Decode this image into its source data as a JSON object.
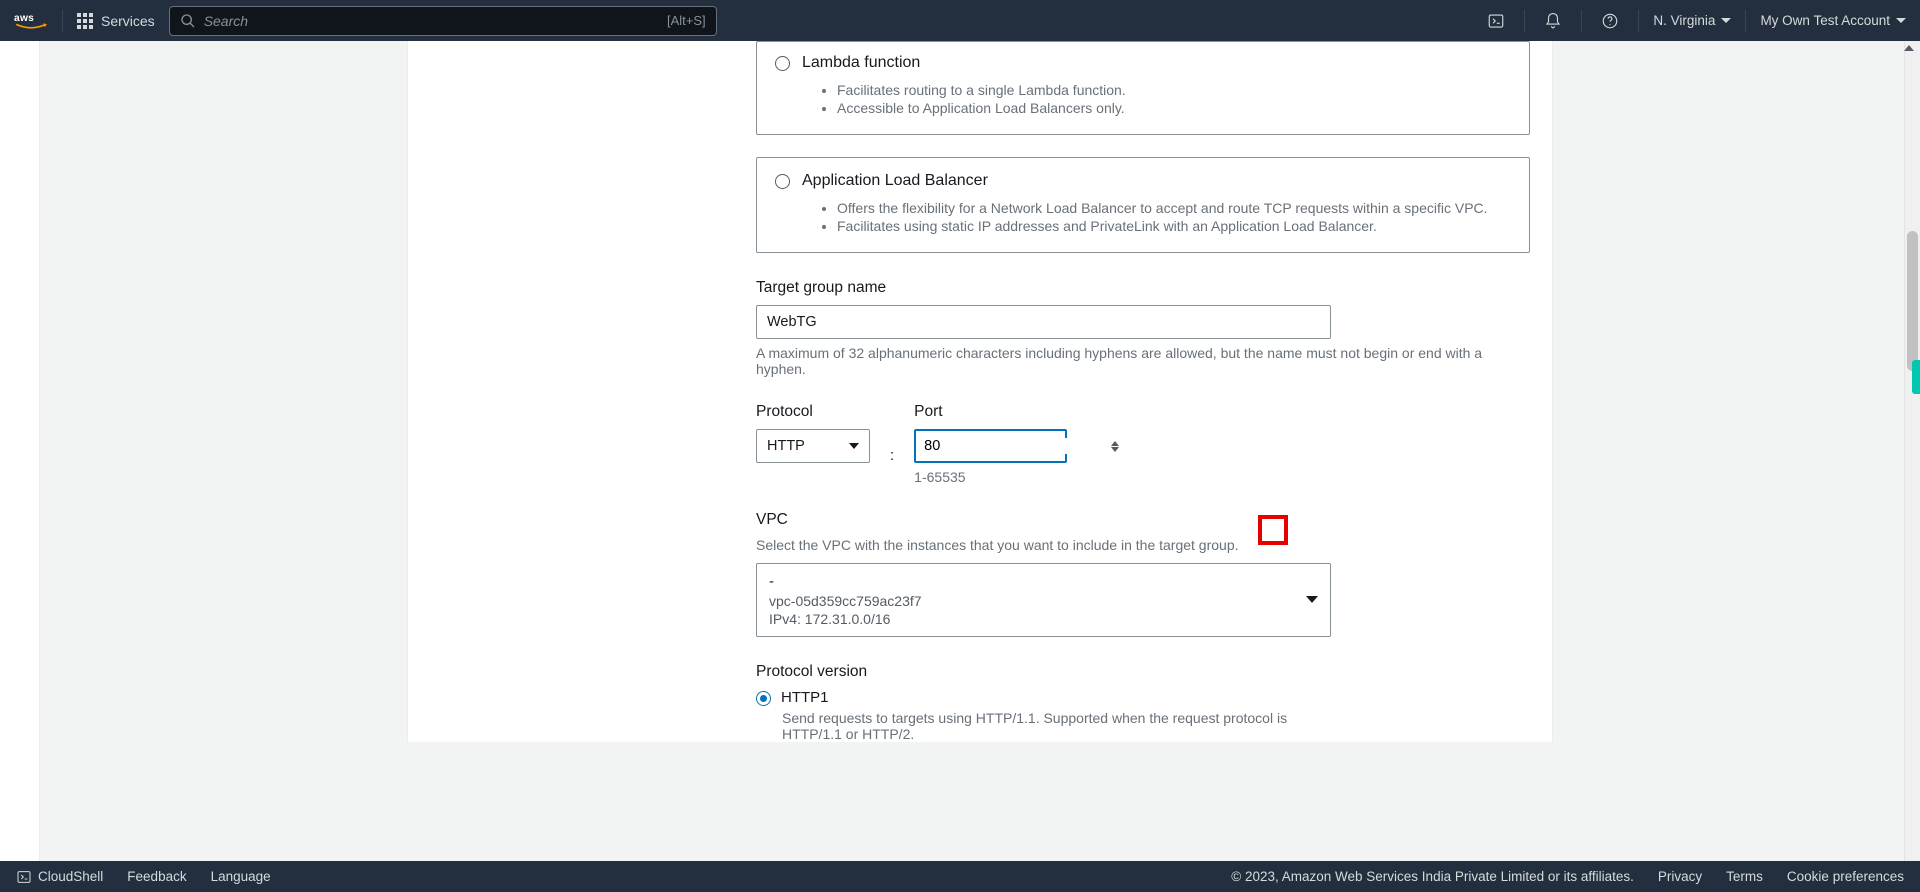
{
  "topbar": {
    "logo_text": "aws",
    "services_label": "Services",
    "search_placeholder": "Search",
    "search_kbd": "[Alt+S]",
    "region_label": "N. Virginia",
    "account_label": "My Own Test Account"
  },
  "options": {
    "lambda": {
      "title": "Lambda function",
      "bullets": [
        "Facilitates routing to a single Lambda function.",
        "Accessible to Application Load Balancers only."
      ]
    },
    "alb": {
      "title": "Application Load Balancer",
      "bullets": [
        "Offers the flexibility for a Network Load Balancer to accept and route TCP requests within a specific VPC.",
        "Facilitates using static IP addresses and PrivateLink with an Application Load Balancer."
      ]
    }
  },
  "target_group": {
    "label": "Target group name",
    "value": "WebTG",
    "hint": "A maximum of 32 alphanumeric characters including hyphens are allowed, but the name must not begin or end with a hyphen."
  },
  "protocol": {
    "label": "Protocol",
    "value": "HTTP"
  },
  "port": {
    "label": "Port",
    "value": "80",
    "hint": "1-65535",
    "separator": ":"
  },
  "vpc": {
    "label": "VPC",
    "hint": "Select the VPC with the instances that you want to include in the target group.",
    "selected_name": "-",
    "selected_id": "vpc-05d359cc759ac23f7",
    "selected_cidr": "IPv4: 172.31.0.0/16"
  },
  "protocol_version": {
    "label": "Protocol version",
    "options": {
      "http1": {
        "title": "HTTP1",
        "desc": "Send requests to targets using HTTP/1.1. Supported when the request protocol is HTTP/1.1 or HTTP/2."
      }
    },
    "selected": "http1"
  },
  "footer": {
    "cloudshell": "CloudShell",
    "feedback": "Feedback",
    "language": "Language",
    "copyright": "© 2023, Amazon Web Services India Private Limited or its affiliates.",
    "privacy": "Privacy",
    "terms": "Terms",
    "cookies": "Cookie preferences"
  }
}
